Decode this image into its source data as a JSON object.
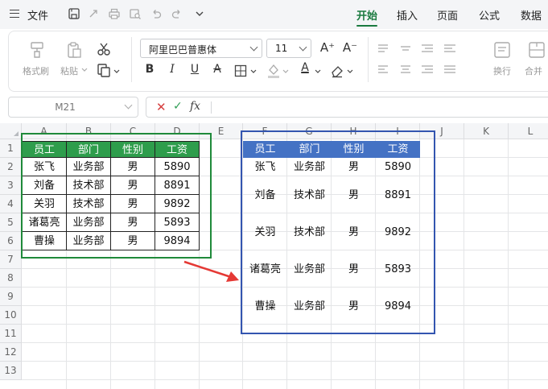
{
  "menu": {
    "file_label": "文件",
    "tabs": [
      {
        "label": "开始",
        "active": true
      },
      {
        "label": "插入",
        "active": false
      },
      {
        "label": "页面",
        "active": false
      },
      {
        "label": "公式",
        "active": false
      },
      {
        "label": "数据",
        "active": false
      }
    ]
  },
  "ribbon": {
    "format_painter_label": "格式刷",
    "paste_label": "粘贴",
    "font_name": "阿里巴巴普惠体",
    "font_size": "11",
    "bold_label": "B",
    "italic_label": "I",
    "underline_label": "U",
    "strike_label": "A",
    "font_color_label": "A",
    "wrap_label": "换行",
    "merge_label": "合并",
    "grow_font_label": "A⁺",
    "shrink_font_label": "A⁻"
  },
  "formula_bar": {
    "name_box": "M21",
    "fx_label": "fx",
    "formula": ""
  },
  "grid": {
    "columns": [
      "A",
      "B",
      "C",
      "D",
      "E",
      "F",
      "G",
      "H",
      "I",
      "J",
      "K",
      "L"
    ],
    "rows": [
      "1",
      "2",
      "3",
      "4",
      "5",
      "6",
      "7",
      "8",
      "9",
      "10",
      "11",
      "12",
      "13"
    ]
  },
  "table_a": {
    "headers": [
      "员工",
      "部门",
      "性别",
      "工资"
    ],
    "rows": [
      [
        "张飞",
        "业务部",
        "男",
        "5890"
      ],
      [
        "刘备",
        "技术部",
        "男",
        "8891"
      ],
      [
        "关羽",
        "技术部",
        "男",
        "9892"
      ],
      [
        "诸葛亮",
        "业务部",
        "男",
        "5893"
      ],
      [
        "曹操",
        "业务部",
        "男",
        "9894"
      ]
    ]
  },
  "table_b": {
    "headers": [
      "员工",
      "部门",
      "性别",
      "工资"
    ],
    "rows": [
      [
        "张飞",
        "业务部",
        "男",
        "5890"
      ],
      [
        "刘备",
        "技术部",
        "男",
        "8891"
      ],
      [
        "关羽",
        "技术部",
        "男",
        "9892"
      ],
      [
        "诸葛亮",
        "业务部",
        "男",
        "5893"
      ],
      [
        "曹操",
        "业务部",
        "男",
        "9894"
      ]
    ]
  },
  "colors": {
    "accent_green": "#1a7a3f",
    "header_green": "#2e9d4c",
    "header_blue": "#4472c4",
    "frame_green": "#1f8a3a",
    "frame_blue": "#3355b0",
    "arrow_red": "#e53935"
  }
}
